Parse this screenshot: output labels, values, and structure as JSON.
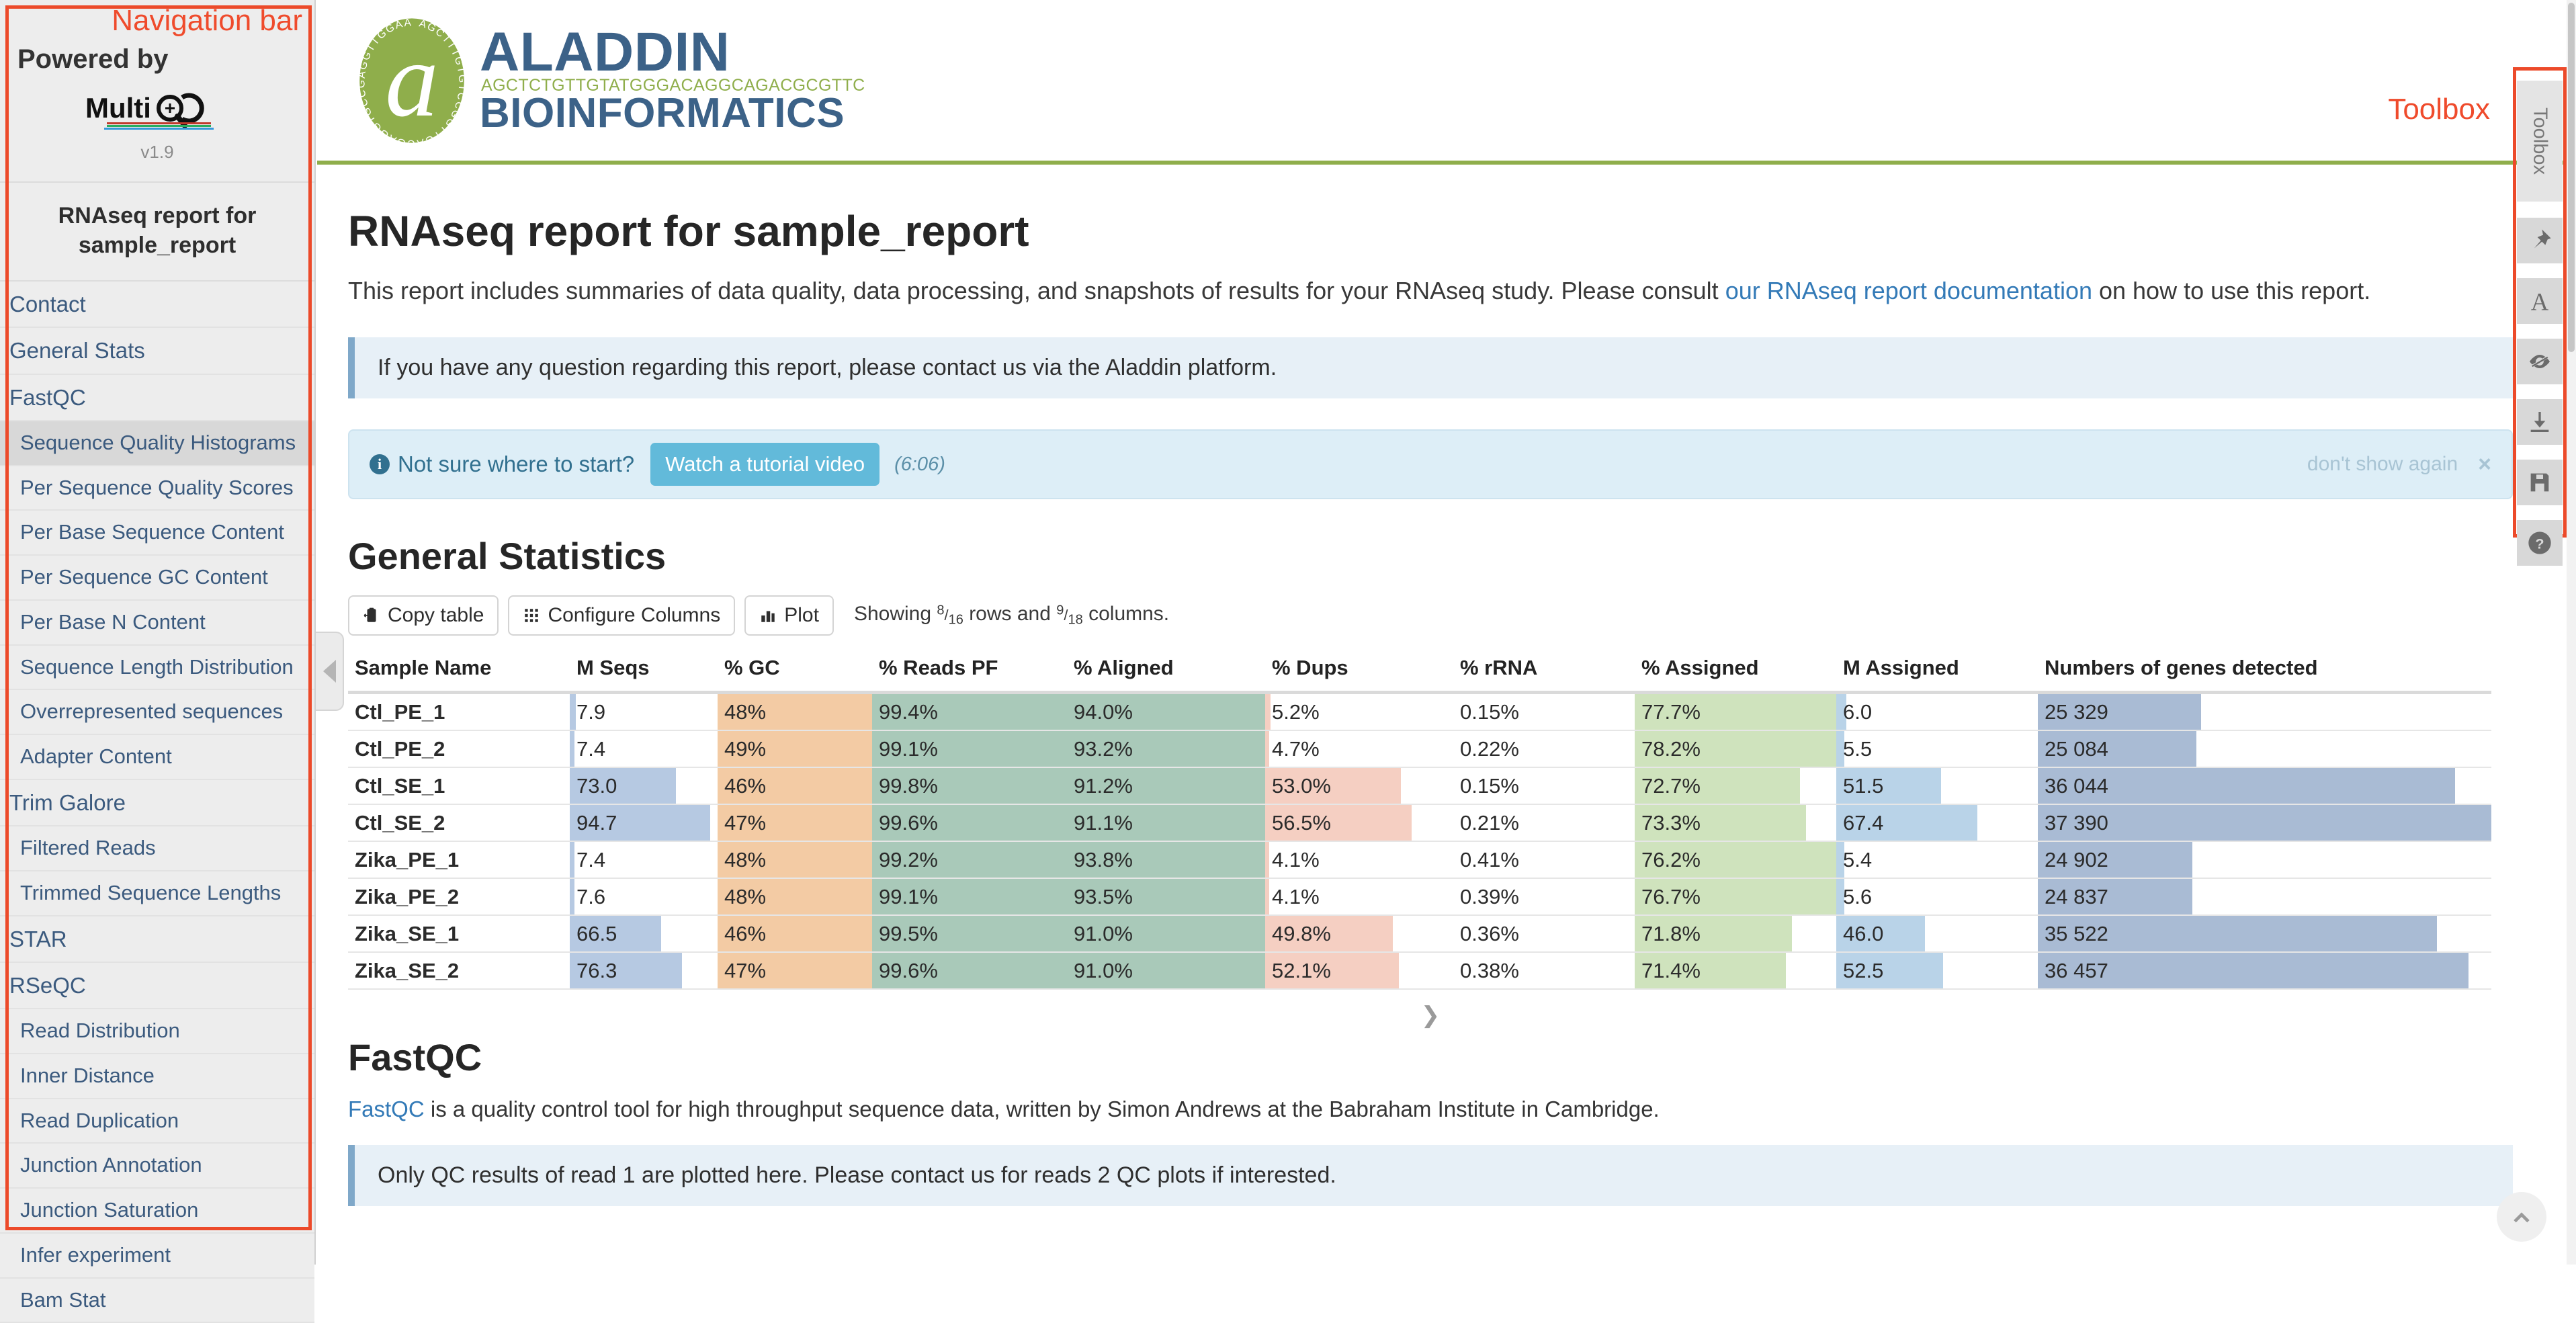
{
  "annotations": {
    "navigation_bar": "Navigation bar",
    "toolbox": "Toolbox"
  },
  "sidebar": {
    "powered_by": "Powered by",
    "logo_text": "MultiQC",
    "version": "v1.9",
    "report_title": "RNAseq report for sample_report",
    "items": [
      {
        "label": "Contact",
        "type": "module"
      },
      {
        "label": "General Stats",
        "type": "module"
      },
      {
        "label": "FastQC",
        "type": "module"
      },
      {
        "label": "Sequence Quality Histograms",
        "type": "sub",
        "active": true
      },
      {
        "label": "Per Sequence Quality Scores",
        "type": "sub"
      },
      {
        "label": "Per Base Sequence Content",
        "type": "sub"
      },
      {
        "label": "Per Sequence GC Content",
        "type": "sub"
      },
      {
        "label": "Per Base N Content",
        "type": "sub"
      },
      {
        "label": "Sequence Length Distribution",
        "type": "sub"
      },
      {
        "label": "Overrepresented sequences",
        "type": "sub"
      },
      {
        "label": "Adapter Content",
        "type": "sub"
      },
      {
        "label": "Trim Galore",
        "type": "module"
      },
      {
        "label": "Filtered Reads",
        "type": "sub"
      },
      {
        "label": "Trimmed Sequence Lengths",
        "type": "sub"
      },
      {
        "label": "STAR",
        "type": "module"
      },
      {
        "label": "RSeQC",
        "type": "module"
      },
      {
        "label": "Read Distribution",
        "type": "sub"
      },
      {
        "label": "Inner Distance",
        "type": "sub"
      },
      {
        "label": "Read Duplication",
        "type": "sub"
      },
      {
        "label": "Junction Annotation",
        "type": "sub"
      },
      {
        "label": "Junction Saturation",
        "type": "sub"
      },
      {
        "label": "Infer experiment",
        "type": "sub"
      },
      {
        "label": "Bam Stat",
        "type": "sub"
      }
    ]
  },
  "masthead": {
    "brand_primary": "ALADDIN",
    "brand_secondary": "BIOINFORMATICS",
    "dna_strip": "AGCTCTGTTGTATGGGACAGGCAGACGCGTTC",
    "accent_color": "#8fae4b",
    "brand_color": "#3c6288"
  },
  "page": {
    "title": "RNAseq report for sample_report",
    "intro_before_link": "This report includes summaries of data quality, data processing, and snapshots of results for your RNAseq study. Please consult ",
    "intro_link": "our RNAseq report documentation",
    "intro_after_link": " on how to use this report.",
    "contact_alert": "If you have any question regarding this report, please contact us via the Aladdin platform."
  },
  "tutorial": {
    "lead": "Not sure where to start?",
    "button": "Watch a tutorial video",
    "duration": "(6:06)",
    "dont_show": "don't show again",
    "close": "×"
  },
  "general_statistics": {
    "heading": "General Statistics",
    "buttons": {
      "copy_table": "Copy table",
      "configure_columns": "Configure Columns",
      "plot": "Plot"
    },
    "showing_prefix": "Showing ",
    "rows_num": "8",
    "rows_den": "16",
    "rows_word": " rows and ",
    "cols_num": "9",
    "cols_den": "18",
    "cols_word": " columns.",
    "more_caret": "❯"
  },
  "chart_data": {
    "type": "table",
    "title": "General Statistics",
    "columns": [
      "Sample Name",
      "M Seqs",
      "% GC",
      "% Reads PF",
      "% Aligned",
      "% Dups",
      "% rRNA",
      "% Assigned",
      "M Assigned",
      "Numbers of genes detected"
    ],
    "rows": [
      {
        "cells": [
          "Ctl_PE_1",
          "7.9",
          "48%",
          "99.4%",
          "94.0%",
          "5.2%",
          "0.15%",
          "77.7%",
          "6.0",
          "25 329"
        ],
        "bars": [
          null,
          0.04,
          1.0,
          1.0,
          1.0,
          0.03,
          0.0,
          1.0,
          0.05,
          0.36
        ]
      },
      {
        "cells": [
          "Ctl_PE_2",
          "7.4",
          "49%",
          "99.1%",
          "93.2%",
          "4.7%",
          "0.22%",
          "78.2%",
          "5.5",
          "25 084"
        ],
        "bars": [
          null,
          0.03,
          1.0,
          1.0,
          1.0,
          0.02,
          0.0,
          1.0,
          0.04,
          0.35
        ]
      },
      {
        "cells": [
          "Ctl_SE_1",
          "73.0",
          "46%",
          "99.8%",
          "91.2%",
          "53.0%",
          "0.15%",
          "72.7%",
          "51.5",
          "36 044"
        ],
        "bars": [
          null,
          0.72,
          1.0,
          1.0,
          1.0,
          0.72,
          0.0,
          0.82,
          0.52,
          0.92
        ]
      },
      {
        "cells": [
          "Ctl_SE_2",
          "94.7",
          "47%",
          "99.6%",
          "91.1%",
          "56.5%",
          "0.21%",
          "73.3%",
          "67.4",
          "37 390"
        ],
        "bars": [
          null,
          0.95,
          1.0,
          1.0,
          1.0,
          0.78,
          0.0,
          0.85,
          0.7,
          1.0
        ]
      },
      {
        "cells": [
          "Zika_PE_1",
          "7.4",
          "48%",
          "99.2%",
          "93.8%",
          "4.1%",
          "0.41%",
          "76.2%",
          "5.4",
          "24 902"
        ],
        "bars": [
          null,
          0.03,
          1.0,
          1.0,
          1.0,
          0.02,
          0.0,
          1.0,
          0.04,
          0.34
        ]
      },
      {
        "cells": [
          "Zika_PE_2",
          "7.6",
          "48%",
          "99.1%",
          "93.5%",
          "4.1%",
          "0.39%",
          "76.7%",
          "5.6",
          "24 837"
        ],
        "bars": [
          null,
          0.03,
          1.0,
          1.0,
          1.0,
          0.02,
          0.0,
          1.0,
          0.04,
          0.34
        ]
      },
      {
        "cells": [
          "Zika_SE_1",
          "66.5",
          "46%",
          "99.5%",
          "91.0%",
          "49.8%",
          "0.36%",
          "71.8%",
          "46.0",
          "35 522"
        ],
        "bars": [
          null,
          0.62,
          1.0,
          1.0,
          1.0,
          0.68,
          0.0,
          0.78,
          0.44,
          0.88
        ]
      },
      {
        "cells": [
          "Zika_SE_2",
          "76.3",
          "47%",
          "99.6%",
          "91.0%",
          "52.1%",
          "0.38%",
          "71.4%",
          "52.5",
          "36 457"
        ],
        "bars": [
          null,
          0.76,
          1.0,
          1.0,
          1.0,
          0.71,
          0.0,
          0.75,
          0.53,
          0.95
        ]
      }
    ],
    "column_bar_colors": [
      null,
      "#b6c9e2",
      "#f3cba4",
      "#a9c9b9",
      "#a9c9b9",
      "#f5cfc2",
      "#ffffff",
      "#cfe3bd",
      "#b9d3e8",
      "#a9bbd4"
    ]
  },
  "fastqc_section": {
    "heading": "FastQC",
    "link": "FastQC",
    "description": " is a quality control tool for high throughput sequence data, written by Simon Andrews at the Babraham Institute in Cambridge.",
    "note": "Only QC results of read 1 are plotted here. Please contact us for reads 2 QC plots if interested."
  },
  "toolbox": {
    "label": "Toolbox",
    "buttons": [
      {
        "name": "pin-icon"
      },
      {
        "name": "rename-icon"
      },
      {
        "name": "hide-icon"
      },
      {
        "name": "download-icon"
      },
      {
        "name": "save-icon"
      },
      {
        "name": "help-icon"
      }
    ]
  }
}
